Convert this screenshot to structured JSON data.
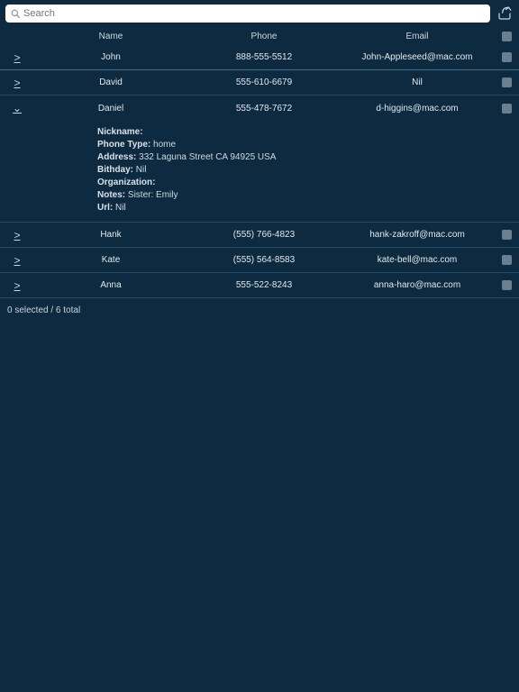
{
  "search": {
    "placeholder": "Search"
  },
  "header": {
    "name": "Name",
    "phone": "Phone",
    "email": "Email"
  },
  "contacts": [
    {
      "name": "John",
      "phone": "888-555-5512",
      "email": "John-Appleseed@mac.com",
      "expanded": false
    },
    {
      "name": "David",
      "phone": "555-610-6679",
      "email": "Nil",
      "expanded": false
    },
    {
      "name": "Daniel",
      "phone": "555-478-7672",
      "email": "d-higgins@mac.com",
      "expanded": true,
      "details": {
        "nickname_label": "Nickname:",
        "nickname": "",
        "phonetype_label": "Phone Type:",
        "phonetype": "home",
        "address_label": "Address:",
        "address": "332 Laguna Street CA 94925 USA",
        "birthday_label": "Bithday:",
        "birthday": "Nil",
        "organization_label": "Organization:",
        "organization": "",
        "notes_label": "Notes:",
        "notes": "Sister: Emily",
        "url_label": "Url:",
        "url": "Nil"
      }
    },
    {
      "name": "Hank",
      "phone": "(555) 766-4823",
      "email": "hank-zakroff@mac.com",
      "expanded": false
    },
    {
      "name": "Kate",
      "phone": "(555) 564-8583",
      "email": "kate-bell@mac.com",
      "expanded": false
    },
    {
      "name": "Anna",
      "phone": "555-522-8243",
      "email": "anna-haro@mac.com",
      "expanded": false
    }
  ],
  "status": "0 selected / 6 total"
}
